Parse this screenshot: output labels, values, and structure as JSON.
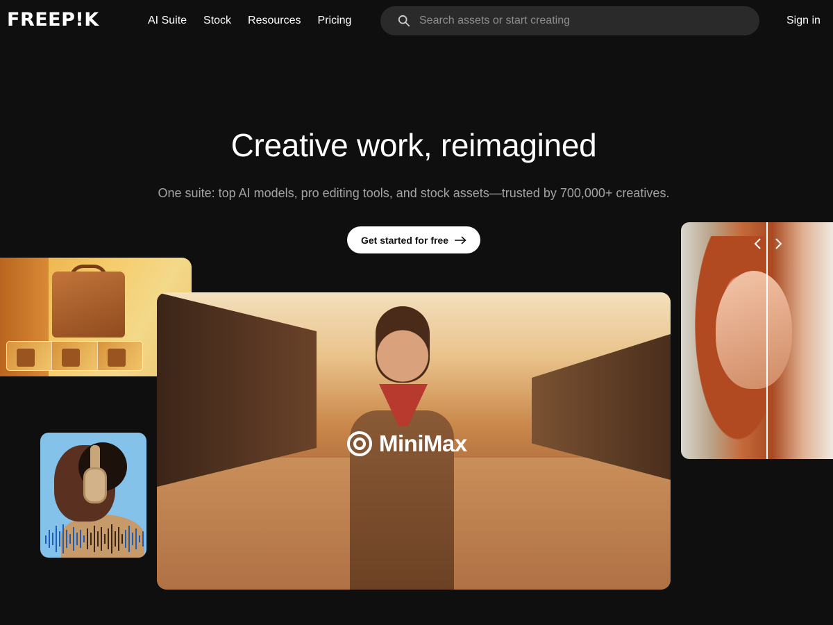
{
  "header": {
    "logo": "FREEP!K",
    "nav": [
      "AI Suite",
      "Stock",
      "Resources",
      "Pricing"
    ],
    "search_placeholder": "Search assets or start creating",
    "signin": "Sign in"
  },
  "hero": {
    "title": "Creative work, reimagined",
    "subtitle": "One suite: top AI models, pro editing tools, and stock assets—trusted by 700,000+ creatives.",
    "cta": "Get started for free"
  },
  "showcase": {
    "main_label": "MiniMax"
  },
  "icons": [
    "search-icon",
    "arrow-right-icon",
    "minimax-logo-icon",
    "chevron-left-icon",
    "chevron-right-icon"
  ],
  "colors": {
    "background": "#0f0f0f",
    "search_bg": "#2a2a2a",
    "cta_bg": "#ffffff",
    "subtitle": "#a3a3a3"
  }
}
